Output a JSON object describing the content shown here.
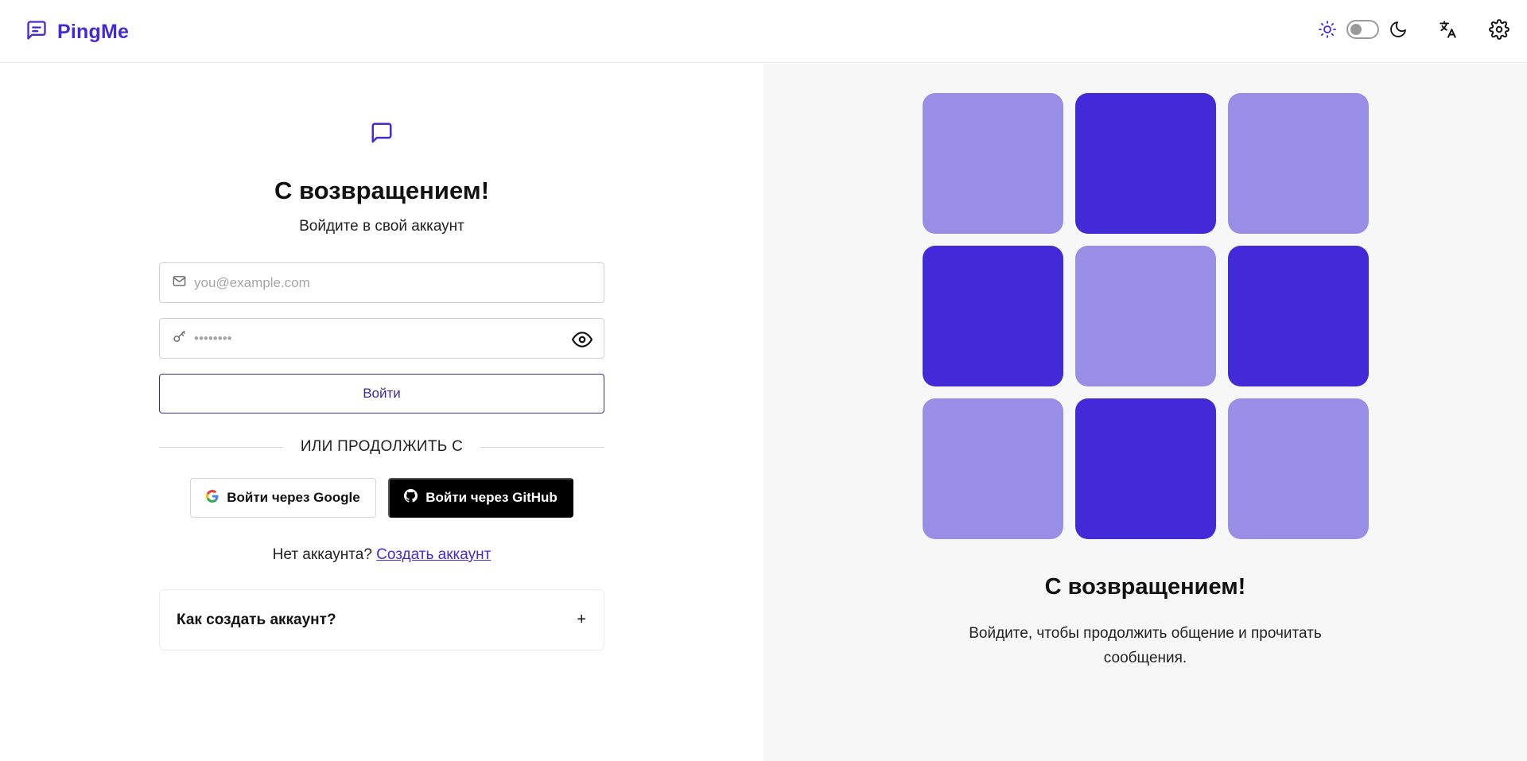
{
  "app": {
    "name": "PingMe"
  },
  "colors": {
    "brand": "#4329d8",
    "tile_light": "#9a8de6",
    "tile_dark": "#4329d8",
    "right_bg": "#f7f7f7"
  },
  "header": {
    "theme_toggle": {
      "light_icon": "sun-icon",
      "dark_icon": "moon-icon",
      "state": "off"
    },
    "translate_icon": "translate-icon",
    "settings_icon": "gear-icon"
  },
  "login": {
    "title": "С возвращением!",
    "subtitle": "Войдите в свой аккаунт",
    "email": {
      "placeholder": "you@example.com",
      "value": ""
    },
    "password": {
      "placeholder": "••••••••",
      "value": ""
    },
    "submit_label": "Войти",
    "divider_text": "ИЛИ ПРОДОЛЖИТЬ С",
    "google_label": "Войти через Google",
    "github_label": "Войти через GitHub",
    "no_account_text": "Нет аккаунта?",
    "create_account_link": "Создать аккаунт",
    "faq": {
      "question": "Как создать аккаунт?",
      "toggle": "+"
    }
  },
  "promo": {
    "tiles": [
      "light",
      "dark",
      "light",
      "dark",
      "light",
      "dark",
      "light",
      "dark",
      "light"
    ],
    "title": "С возвращением!",
    "text": "Войдите, чтобы продолжить общение и прочитать сообщения."
  }
}
